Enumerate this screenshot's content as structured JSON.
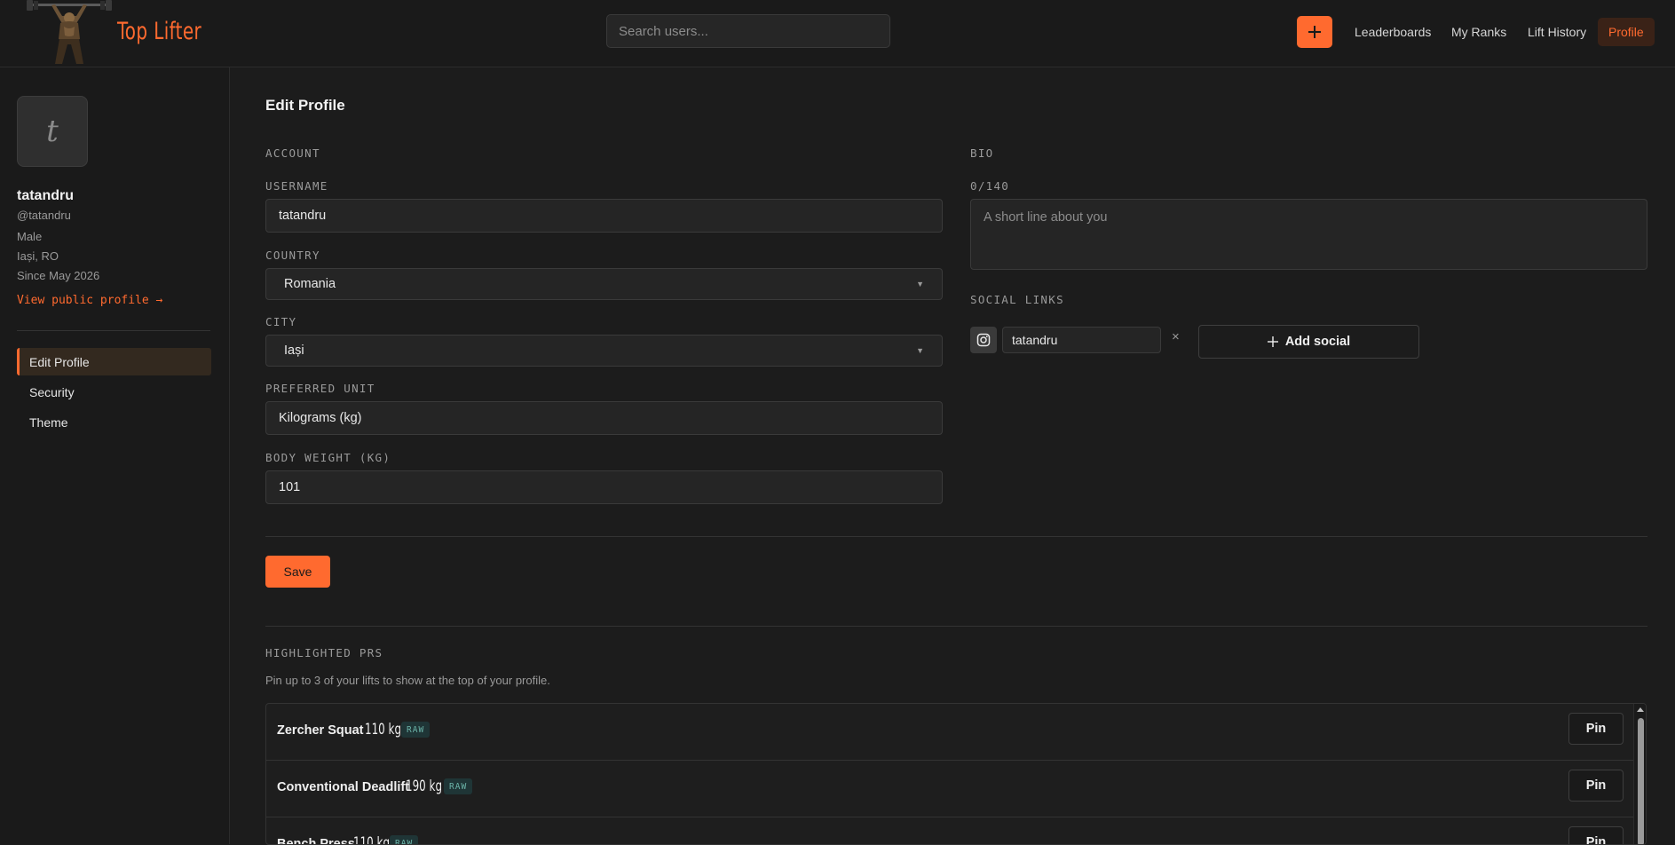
{
  "header": {
    "brand": "Top Lifter",
    "search_placeholder": "Search users...",
    "add_label": "+",
    "nav": [
      {
        "label": "Leaderboards",
        "active": false
      },
      {
        "label": "My Ranks",
        "active": false
      },
      {
        "label": "Lift History",
        "active": false
      },
      {
        "label": "Profile",
        "active": true
      }
    ],
    "accent_color": "#ff6a2f"
  },
  "sidebar": {
    "avatar_letter": "t",
    "display_name": "tatandru",
    "handle": "@tatandru",
    "gender": "Male",
    "location": "Iași, RO",
    "since": "Since May 2026",
    "public_link": "View public profile →",
    "items": [
      {
        "label": "Edit Profile",
        "active": true
      },
      {
        "label": "Security",
        "active": false
      },
      {
        "label": "Theme",
        "active": false
      }
    ]
  },
  "main": {
    "title": "Edit Profile",
    "account_label": "ACCOUNT",
    "username_label": "USERNAME",
    "username_value": "tatandru",
    "country_label": "COUNTRY",
    "country_value": "Romania",
    "city_label": "CITY",
    "city_value": "Iași",
    "unit_label": "PREFERRED UNIT",
    "unit_value": "Kilograms (kg)",
    "bodyweight_label": "BODY WEIGHT (KG)",
    "bodyweight_value": "101",
    "bio_label": "BIO",
    "bio_counter": "0/140",
    "bio_placeholder": "A short line about you",
    "social_label": "SOCIAL LINKS",
    "social_links": [
      {
        "platform_icon": "instagram-icon",
        "value": "tatandru"
      }
    ],
    "remove_label": "×",
    "add_social_label": "Add social",
    "save_label": "Save",
    "highlighted_label": "HIGHLIGHTED PRS",
    "highlighted_hint": "Pin up to 3 of your lifts to show at the top of your profile.",
    "prs": [
      {
        "name": "Zercher Squat",
        "weight": "110 kg",
        "badge": "RAW",
        "pin_label": "Pin"
      },
      {
        "name": "Conventional Deadlift",
        "weight": "190 kg",
        "badge": "RAW",
        "pin_label": "Pin"
      },
      {
        "name": "Bench Press",
        "weight": "110 kg",
        "badge": "RAW",
        "pin_label": "Pin"
      }
    ]
  }
}
